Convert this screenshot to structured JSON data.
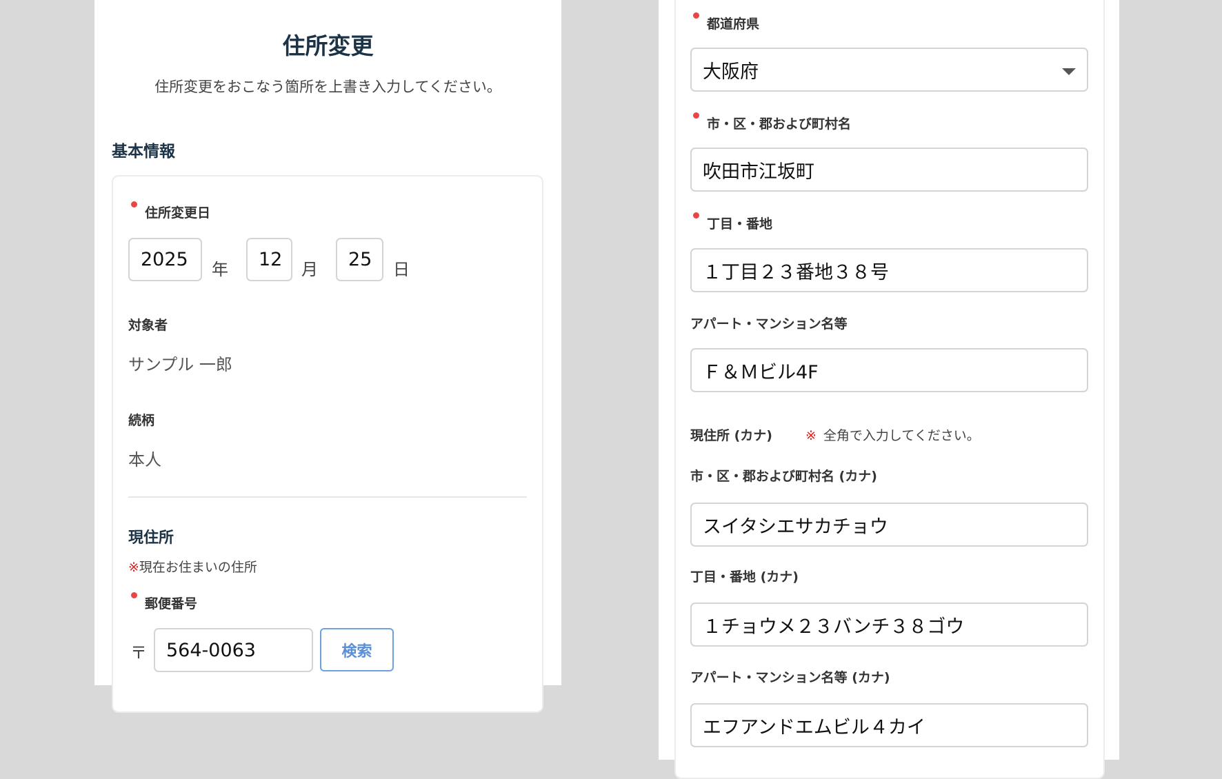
{
  "page": {
    "title": "住所変更",
    "subtitle": "住所変更をおこなう箇所を上書き入力してください。"
  },
  "basic": {
    "heading": "基本情報",
    "change_date": {
      "label": "住所変更日",
      "year": "2025",
      "year_unit": "年",
      "month": "12",
      "month_unit": "月",
      "day": "25",
      "day_unit": "日"
    },
    "target_person": {
      "label": "対象者",
      "value": "サンプル 一郎"
    },
    "relationship": {
      "label": "続柄",
      "value": "本人"
    }
  },
  "current_address": {
    "heading": "現住所",
    "note_mark": "※",
    "note": "現在お住まいの住所",
    "postal": {
      "label": "郵便番号",
      "symbol": "〒",
      "value": "564-0063",
      "search_label": "検索"
    },
    "prefecture": {
      "label": "都道府県",
      "value": "大阪府"
    },
    "city": {
      "label": "市・区・郡および町村名",
      "value": "吹田市江坂町"
    },
    "block": {
      "label": "丁目・番地",
      "value": "１丁目２３番地３８号"
    },
    "building": {
      "label": "アパート・マンション名等",
      "value": "Ｆ＆Ｍビル4F"
    }
  },
  "kana": {
    "heading": "現住所 (カナ)",
    "note_mark": "※",
    "note": "全角で入力してください。",
    "city": {
      "label": "市・区・郡および町村名 (カナ)",
      "value": "スイタシエサカチョウ"
    },
    "block": {
      "label": "丁目・番地 (カナ)",
      "value": "１チョウメ２３バンチ３８ゴウ"
    },
    "building": {
      "label": "アパート・マンション名等 (カナ)",
      "value": "エフアンドエムビル４カイ"
    }
  },
  "colors": {
    "heading": "#1c3347",
    "required": "#e84545",
    "accent": "#5b8fd6"
  }
}
